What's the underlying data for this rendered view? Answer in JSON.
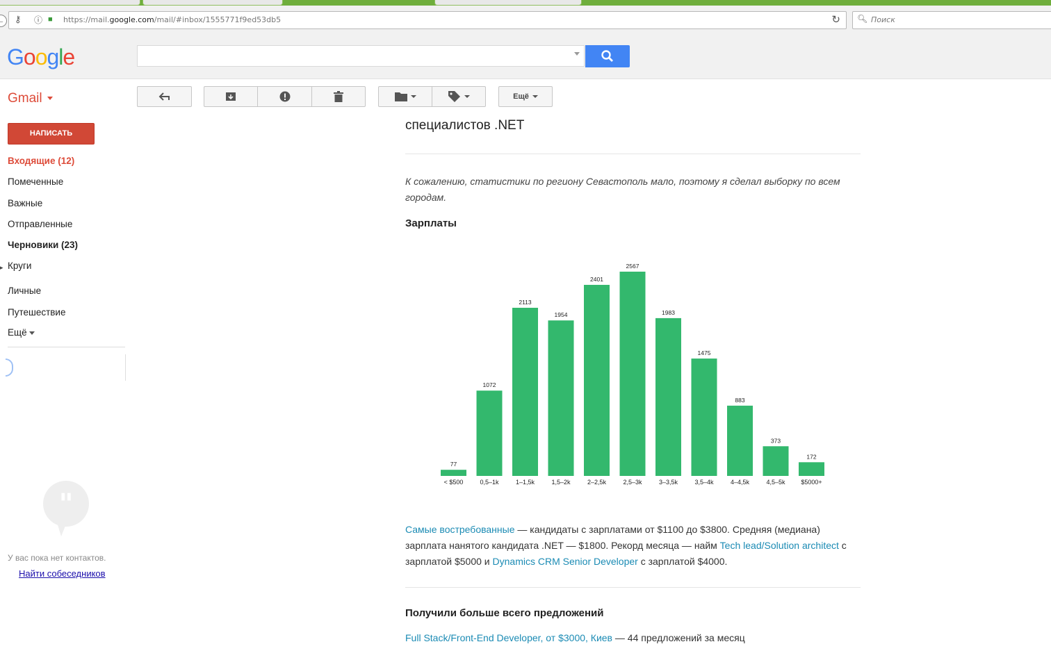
{
  "browser": {
    "url_prefix": "https://mail.",
    "url_domain": "google.com",
    "url_suffix": "/mail/#inbox/1555771f9ed53db5",
    "search_placeholder": "Поиск"
  },
  "header": {
    "logo": [
      "G",
      "o",
      "o",
      "g",
      "l",
      "e"
    ],
    "logo_colors": [
      "#4285f4",
      "#ea4335",
      "#fbbc05",
      "#4285f4",
      "#34a853",
      "#ea4335"
    ],
    "search_value": ""
  },
  "toolbar": {
    "app_label": "Gmail",
    "more_label": "Ещё"
  },
  "sidebar": {
    "compose_label": "НАПИСАТЬ",
    "items": [
      {
        "label": "Входящие (12)"
      },
      {
        "label": "Помеченные"
      },
      {
        "label": "Важные"
      },
      {
        "label": "Отправленные"
      },
      {
        "label": "Черновики (23)"
      },
      {
        "label": "Круги"
      },
      {
        "label": "Личные"
      },
      {
        "label": "Путешествие"
      },
      {
        "label": "Ещё"
      }
    ],
    "no_contacts": "У вас пока нет контактов.",
    "find_link": "Найти собеседников"
  },
  "message": {
    "title": "специалистов .NET",
    "intro": "К сожалению, статистики по региону Севастополь мало, поэтому я сделал выборку по всем городам.",
    "salaries_heading": "Зарплаты",
    "para": {
      "link1": "Самые востребованные",
      "text1": " — кандидаты с зарплатами от $1100 до $3800. Средняя (медиана) зарплата нанятого кандидата .NET — $1800. Рекорд месяца — найм ",
      "link2": "Tech lead/Solution architect",
      "text2": " с зарплатой $5000 и ",
      "link3": "Dynamics CRM Senior Developer",
      "text3": " с зарплатой $4000."
    },
    "offers_heading": "Получили больше всего предложений",
    "last_link": "Full Stack/Front-End Developer, от $3000, Киев",
    "last_text": " — 44 предложений за месяц"
  },
  "chart_data": {
    "type": "bar",
    "categories": [
      "< $500",
      "0,5–1k",
      "1–1,5k",
      "1,5–2k",
      "2–2,5k",
      "2,5–3k",
      "3–3,5k",
      "3,5–4k",
      "4–4,5k",
      "4,5–5k",
      "$5000+"
    ],
    "values": [
      77,
      1072,
      2113,
      1954,
      2401,
      2567,
      1983,
      1475,
      883,
      373,
      172
    ],
    "bar_color": "#33b86d",
    "ylim": [
      0,
      2567
    ],
    "grid": false,
    "legend": "none"
  }
}
